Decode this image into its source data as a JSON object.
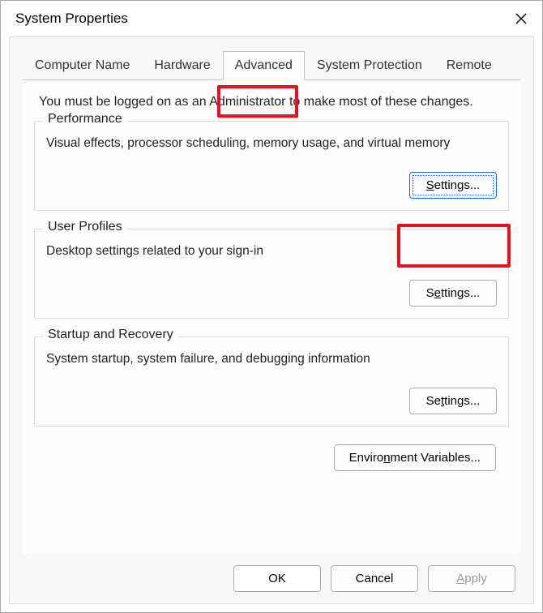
{
  "window": {
    "title": "System Properties"
  },
  "tabs": {
    "computer_name": "Computer Name",
    "hardware": "Hardware",
    "advanced": "Advanced",
    "system_protection": "System Protection",
    "remote": "Remote"
  },
  "advanced_pane": {
    "notice": "You must be logged on as an Administrator to make most of these changes.",
    "performance": {
      "legend": "Performance",
      "desc": "Visual effects, processor scheduling, memory usage, and virtual memory",
      "button": "Settings..."
    },
    "user_profiles": {
      "legend": "User Profiles",
      "desc": "Desktop settings related to your sign-in",
      "button": "Settings..."
    },
    "startup_recovery": {
      "legend": "Startup and Recovery",
      "desc": "System startup, system failure, and debugging information",
      "button": "Settings..."
    },
    "env_vars_button": "Environment Variables..."
  },
  "buttons": {
    "ok": "OK",
    "cancel": "Cancel",
    "apply": "Apply"
  }
}
